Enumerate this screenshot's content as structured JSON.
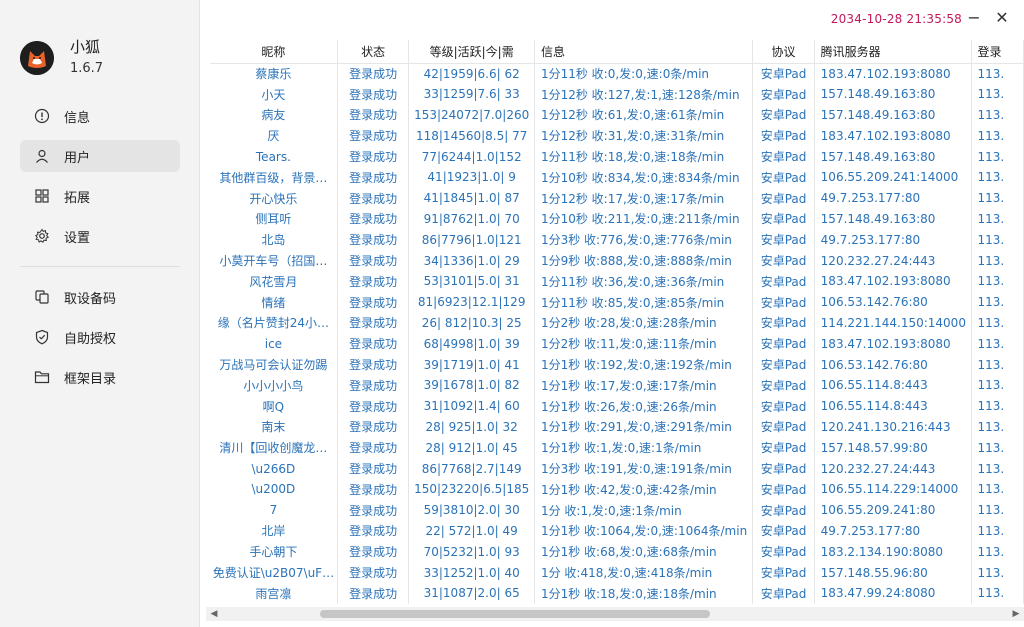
{
  "app": {
    "name": "小狐",
    "version": "1.6.7"
  },
  "titlebar": {
    "clock": "2034-10-28 21:35:58",
    "minimize": "−",
    "close": "✕"
  },
  "sidebar": {
    "items": [
      {
        "label": "信息",
        "icon": "info-icon",
        "active": false
      },
      {
        "label": "用户",
        "icon": "user-icon",
        "active": true
      },
      {
        "label": "拓展",
        "icon": "grid-icon",
        "active": false
      },
      {
        "label": "设置",
        "icon": "gear-icon",
        "active": false
      }
    ],
    "items2": [
      {
        "label": "取设备码",
        "icon": "copy-icon"
      },
      {
        "label": "自助授权",
        "icon": "shield-icon"
      },
      {
        "label": "框架目录",
        "icon": "folder-icon"
      }
    ]
  },
  "table": {
    "headers": [
      "昵称",
      "状态",
      "等级|活跃|今|需",
      "信息",
      "协议",
      "腾讯服务器",
      "登录"
    ],
    "rows": [
      [
        "蔡康乐",
        "登录成功",
        "42|1959|6.6| 62",
        "1分11秒 收:0,发:0,速:0条/min",
        "安卓Pad",
        "183.47.102.193:8080",
        "113."
      ],
      [
        "小天",
        "登录成功",
        "33|1259|7.6| 33",
        "1分12秒 收:127,发:1,速:128条/min",
        "安卓Pad",
        "157.148.49.163:80",
        "113."
      ],
      [
        "病友",
        "登录成功",
        "153|24072|7.0|260",
        "1分12秒 收:61,发:0,速:61条/min",
        "安卓Pad",
        "157.148.49.163:80",
        "113."
      ],
      [
        "厌",
        "登录成功",
        "118|14560|8.5| 77",
        "1分12秒 收:31,发:0,速:31条/min",
        "安卓Pad",
        "183.47.102.193:8080",
        "113."
      ],
      [
        "Tears.",
        "登录成功",
        "77|6244|1.0|152",
        "1分11秒 收:18,发:0,速:18条/min",
        "安卓Pad",
        "157.148.49.163:80",
        "113."
      ],
      [
        "其他群百级，背景…",
        "登录成功",
        "41|1923|1.0|  9",
        "1分10秒 收:834,发:0,速:834条/min",
        "安卓Pad",
        "106.55.209.241:14000",
        "113."
      ],
      [
        "开心快乐",
        "登录成功",
        "41|1845|1.0| 87",
        "1分12秒 收:17,发:0,速:17条/min",
        "安卓Pad",
        "49.7.253.177:80",
        "113."
      ],
      [
        "侧耳听",
        "登录成功",
        "91|8762|1.0| 70",
        "1分10秒 收:211,发:0,速:211条/min",
        "安卓Pad",
        "157.148.49.163:80",
        "113."
      ],
      [
        "北岛",
        "登录成功",
        "86|7796|1.0|121",
        "1分3秒 收:776,发:0,速:776条/min",
        "安卓Pad",
        "49.7.253.177:80",
        "113."
      ],
      [
        "小莫开车号（招国…",
        "登录成功",
        "34|1336|1.0| 29",
        "1分9秒 收:888,发:0,速:888条/min",
        "安卓Pad",
        "120.232.27.24:443",
        "113."
      ],
      [
        "风花雪月",
        "登录成功",
        "53|3101|5.0| 31",
        "1分11秒 收:36,发:0,速:36条/min",
        "安卓Pad",
        "183.47.102.193:8080",
        "113."
      ],
      [
        "情绪",
        "登录成功",
        "81|6923|12.1|129",
        "1分11秒 收:85,发:0,速:85条/min",
        "安卓Pad",
        "106.53.142.76:80",
        "113."
      ],
      [
        "缘（名片赞封24小…",
        "登录成功",
        "26| 812|10.3| 25",
        "1分2秒 收:28,发:0,速:28条/min",
        "安卓Pad",
        "114.221.144.150:14000",
        "113."
      ],
      [
        "ice",
        "登录成功",
        "68|4998|1.0| 39",
        "1分2秒 收:11,发:0,速:11条/min",
        "安卓Pad",
        "183.47.102.193:8080",
        "113."
      ],
      [
        "万战马可会认证勿踢",
        "登录成功",
        "39|1719|1.0| 41",
        "1分1秒 收:192,发:0,速:192条/min",
        "安卓Pad",
        "106.53.142.76:80",
        "113."
      ],
      [
        "小小小小鸟",
        "登录成功",
        "39|1678|1.0| 82",
        "1分1秒 收:17,发:0,速:17条/min",
        "安卓Pad",
        "106.55.114.8:443",
        "113."
      ],
      [
        "啊Q",
        "登录成功",
        "31|1092|1.4| 60",
        "1分1秒 收:26,发:0,速:26条/min",
        "安卓Pad",
        "106.55.114.8:443",
        "113."
      ],
      [
        "南末",
        "登录成功",
        "28| 925|1.0| 32",
        "1分1秒 收:291,发:0,速:291条/min",
        "安卓Pad",
        "120.241.130.216:443",
        "113."
      ],
      [
        "清川【回收创魔龙…",
        "登录成功",
        "28| 912|1.0| 45",
        "1分1秒 收:1,发:0,速:1条/min",
        "安卓Pad",
        "157.148.57.99:80",
        "113."
      ],
      [
        "\\u266D",
        "登录成功",
        "86|7768|2.7|149",
        "1分3秒 收:191,发:0,速:191条/min",
        "安卓Pad",
        "120.232.27.24:443",
        "113."
      ],
      [
        "\\u200D",
        "登录成功",
        "150|23220|6.5|185",
        "1分1秒 收:42,发:0,速:42条/min",
        "安卓Pad",
        "106.55.114.229:14000",
        "113."
      ],
      [
        "7",
        "登录成功",
        "59|3810|2.0| 30",
        "1分 收:1,发:0,速:1条/min",
        "安卓Pad",
        "106.55.209.241:80",
        "113."
      ],
      [
        "北岸",
        "登录成功",
        "22| 572|1.0| 49",
        "1分1秒 收:1064,发:0,速:1064条/min",
        "安卓Pad",
        "49.7.253.177:80",
        "113."
      ],
      [
        "手心朝下",
        "登录成功",
        "70|5232|1.0| 93",
        "1分1秒 收:68,发:0,速:68条/min",
        "安卓Pad",
        "183.2.134.190:8080",
        "113."
      ],
      [
        "免费认证\\u2B07\\uF…",
        "登录成功",
        "33|1252|1.0| 40",
        "1分 收:418,发:0,速:418条/min",
        "安卓Pad",
        "157.148.55.96:80",
        "113."
      ],
      [
        "雨宫凛",
        "登录成功",
        "31|1087|2.0| 65",
        "1分1秒 收:18,发:0,速:18条/min",
        "安卓Pad",
        "183.47.99.24:8080",
        "113."
      ]
    ]
  },
  "colors": {
    "cell_text": "#2b73b8",
    "clock": "#c2185b",
    "active_item": "#e4e4e4"
  }
}
